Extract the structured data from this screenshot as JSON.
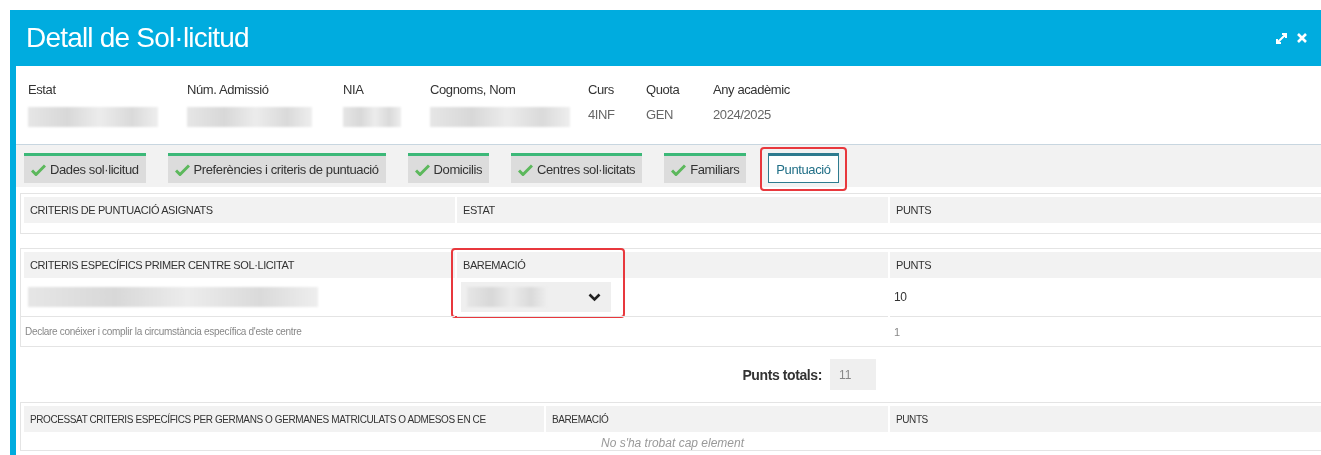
{
  "window": {
    "title": "Detall de Sol·licitud"
  },
  "summary": [
    {
      "label": "Estat",
      "kind": "blurred"
    },
    {
      "label": "Núm. Admissió",
      "kind": "blurred"
    },
    {
      "label": "NIA",
      "kind": "blurred"
    },
    {
      "label": "Cognoms, Nom",
      "kind": "blurred"
    },
    {
      "label": "Curs",
      "kind": "text",
      "value": "4INF"
    },
    {
      "label": "Quota",
      "kind": "text",
      "value": "GEN"
    },
    {
      "label": "Any acadèmic",
      "kind": "text",
      "value": "2024/2025"
    }
  ],
  "tabs": [
    {
      "label": "Dades sol·licitud",
      "completed": true,
      "selected": false,
      "highlighted": false
    },
    {
      "label": "Preferències i criteris de puntuació",
      "completed": true,
      "selected": false,
      "highlighted": false
    },
    {
      "label": "Domicilis",
      "completed": true,
      "selected": false,
      "highlighted": false
    },
    {
      "label": "Centres sol·licitats",
      "completed": true,
      "selected": false,
      "highlighted": false
    },
    {
      "label": "Familiars",
      "completed": true,
      "selected": false,
      "highlighted": false
    },
    {
      "label": "Puntuació",
      "completed": false,
      "selected": true,
      "highlighted": true
    }
  ],
  "assigned_table": {
    "columns": [
      {
        "label": "CRITERIS DE PUNTUACIÓ ASIGNATS"
      },
      {
        "label": "ESTAT"
      },
      {
        "label": "PUNTS"
      }
    ]
  },
  "specific_table": {
    "columns": [
      {
        "label": "CRITERIS ESPECÍFICS PRIMER CENTRE SOL·LICITAT",
        "highlighted": false
      },
      {
        "label": "BAREMACIÓ",
        "highlighted": true
      },
      {
        "label": "PUNTS",
        "highlighted": false
      }
    ],
    "rows": [
      {
        "kind": "select",
        "punts": "10"
      },
      {
        "kind": "note",
        "text": "Declare conéixer i complir la circumstància específica d'este centre",
        "punts": "1"
      }
    ]
  },
  "totals": {
    "label": "Punts totals:",
    "value": "11"
  },
  "siblings_table": {
    "columns": [
      {
        "label": "PROCESSAT CRITERIS ESPECÍFICS PER GERMANS O GERMANES MATRICULATS O ADMESOS EN CE"
      },
      {
        "label": "BAREMACIÓ"
      },
      {
        "label": "PUNTS"
      }
    ],
    "empty_message": "No s'ha trobat cap element"
  }
}
